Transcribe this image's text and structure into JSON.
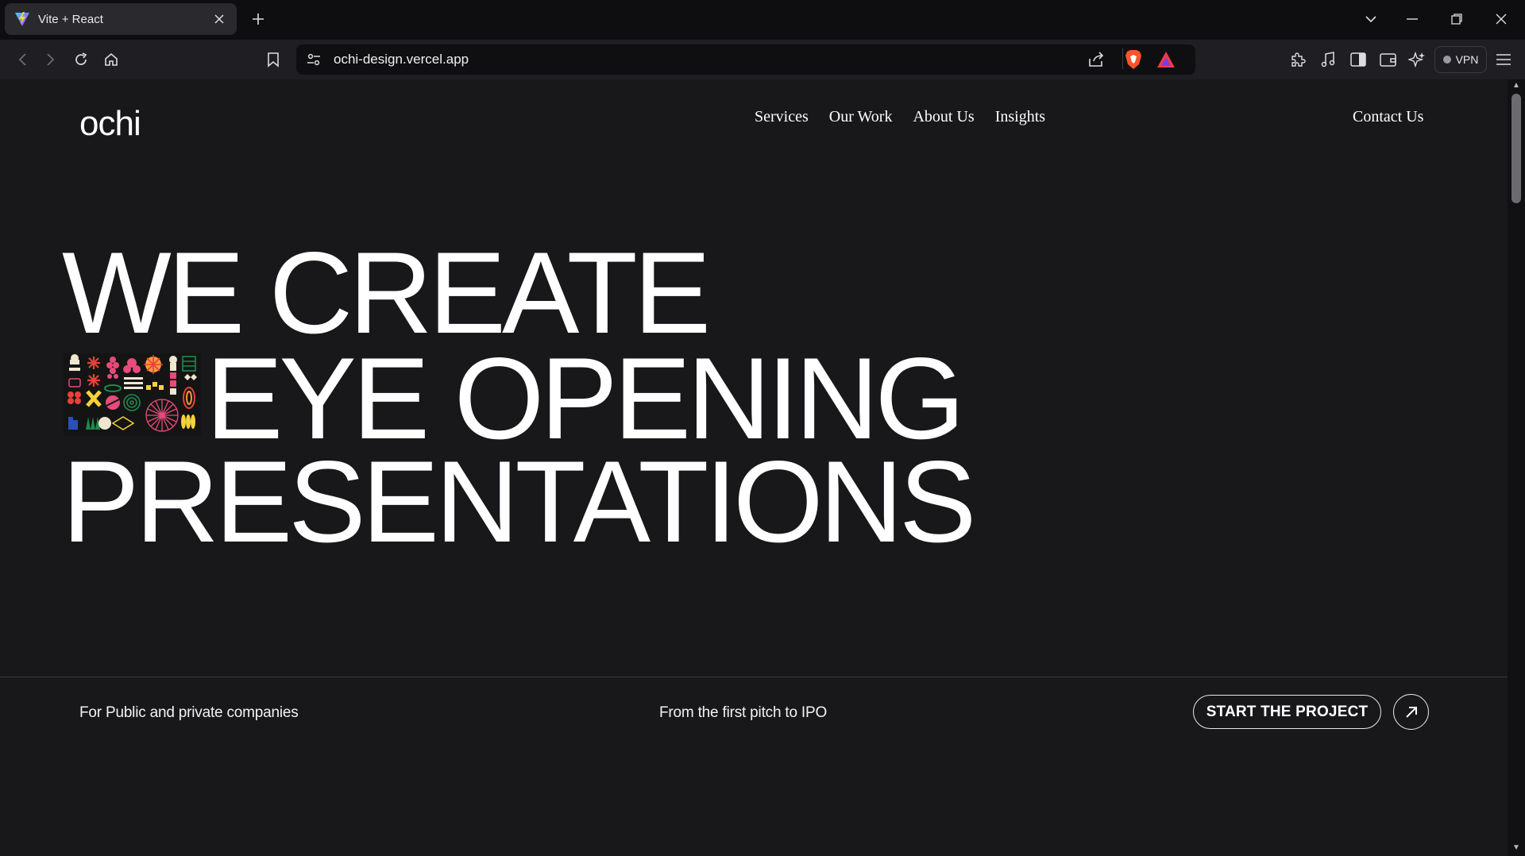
{
  "browser": {
    "tab_title": "Vite + React",
    "url": "ochi-design.vercel.app",
    "vpn_label": "VPN"
  },
  "site": {
    "logo": "ochi",
    "nav": [
      "Services",
      "Our Work",
      "About Us",
      "Insights"
    ],
    "contact": "Contact Us",
    "hero": {
      "line1": "WE CREATE",
      "line2": "EYE OPENING",
      "line3": "PRESENTATIONS"
    },
    "bottom_left": "For Public and private companies",
    "bottom_middle": "From the first pitch to IPO",
    "cta_label": "START THE PROJECT"
  },
  "colors": {
    "page_bg": "#18181b",
    "text": "#ffffff",
    "pattern_red": "#e8413a",
    "pattern_pink": "#e84a7a",
    "pattern_yellow": "#f5d23a",
    "pattern_cream": "#efe6cf",
    "pattern_green": "#1f8a4c",
    "pattern_blue": "#2a4fb8"
  }
}
